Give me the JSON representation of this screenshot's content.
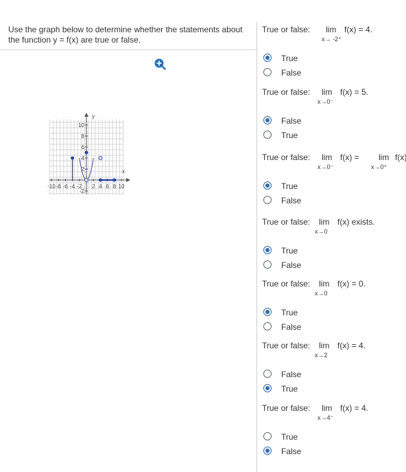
{
  "instruction": "Use the graph below to determine whether the statements about the function y = f(x) are true or false.",
  "graph": {
    "x_axis_label": "x",
    "y_axis_label": "y",
    "x_ticks": [
      "-10",
      "-8",
      "-6",
      "-4",
      "-2",
      "2",
      "4",
      "6",
      "8",
      "10"
    ],
    "y_ticks": [
      "10",
      "8",
      "6",
      "4",
      "2",
      "-2"
    ]
  },
  "prompt_label": "True or false:",
  "questions": [
    {
      "lim": "lim",
      "sub": "x→ -2⁺",
      "expr": "f(x) = 4.",
      "options": [
        "True",
        "False"
      ],
      "selected": 0
    },
    {
      "lim": "lim",
      "sub": "x→0⁻",
      "expr": "f(x) = 5.",
      "options": [
        "False",
        "True"
      ],
      "selected": 0
    },
    {
      "lim": "lim",
      "sub": "x→0⁻",
      "expr": "f(x) =",
      "lim2": "lim",
      "sub2": "x→0⁺",
      "expr2": "f(x).",
      "options": [
        "True",
        "False"
      ],
      "selected": 0
    },
    {
      "lim": "lim",
      "sub": "x→0",
      "expr": "f(x) exists.",
      "options": [
        "True",
        "False"
      ],
      "selected": 0
    },
    {
      "lim": "lim",
      "sub": "x→0",
      "expr": "f(x) = 0.",
      "options": [
        "True",
        "False"
      ],
      "selected": 0
    },
    {
      "lim": "lim",
      "sub": "x→2",
      "expr": "f(x) = 4.",
      "options": [
        "False",
        "True"
      ],
      "selected": 1
    },
    {
      "lim": "lim",
      "sub": "x→4⁻",
      "expr": "f(x) = 4.",
      "options": [
        "True",
        "False"
      ],
      "selected": 1
    }
  ],
  "colors": {
    "curve": "#7b68c8",
    "point": "#1f3fbf",
    "radio": "#2b6cb8"
  }
}
